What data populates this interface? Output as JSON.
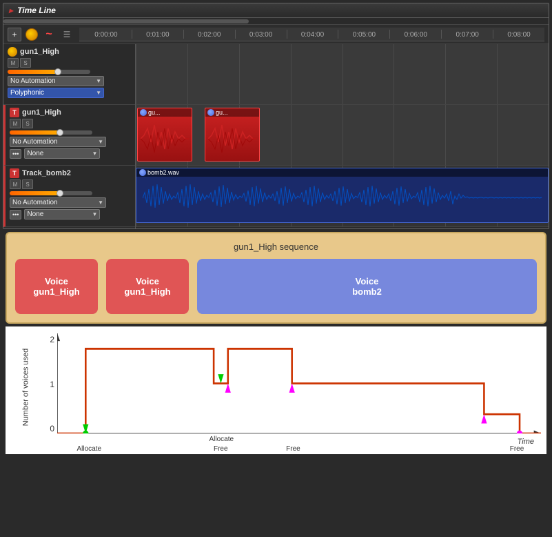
{
  "timeline": {
    "title": "Time Line",
    "toolbar": {
      "add_label": "+",
      "wave_label": "~",
      "list_label": "≡"
    },
    "ruler": {
      "marks": [
        "0:00:00",
        "0:01:00",
        "0:02:00",
        "0:03:00",
        "0:04:00",
        "0:05:00",
        "0:06:00",
        "0:07:00",
        "0:08:00"
      ]
    },
    "tracks": [
      {
        "id": "track1",
        "name": "gun1_High",
        "type": "circle",
        "automation": "No Automation",
        "mode": "Polyphonic"
      },
      {
        "id": "track2",
        "name": "gun1_High",
        "type": "T",
        "automation": "No Automation",
        "mode": "None",
        "clips": [
          {
            "label": "gu...",
            "start_pct": 0,
            "width_pct": 22
          },
          {
            "label": "gu...",
            "start_pct": 26,
            "width_pct": 18
          }
        ]
      },
      {
        "id": "track3",
        "name": "Track_bomb2",
        "type": "T",
        "automation": "No Automation",
        "mode": "None",
        "clip_label": "bomb2.wav"
      }
    ]
  },
  "sequence": {
    "title": "gun1_High sequence",
    "voices": [
      {
        "label": "Voice",
        "sublabel": "gun1_High"
      },
      {
        "label": "Voice",
        "sublabel": "gun1_High"
      }
    ],
    "bomb_voice": {
      "label": "Voice",
      "sublabel": "bomb2"
    }
  },
  "graph": {
    "y_label": "Number of voices used",
    "y_axis": [
      "2",
      "1",
      "0"
    ],
    "x_labels": [
      {
        "text": "Allocate",
        "arrow": "up",
        "arrow_color": "green"
      },
      {
        "text": "Allocate",
        "arrow": "up",
        "arrow_color": "green"
      },
      {
        "text": "Free",
        "arrow": "down",
        "arrow_color": "magenta"
      },
      {
        "text": "Free",
        "arrow": "down",
        "arrow_color": "magenta"
      },
      {
        "text": "Free",
        "arrow": "down",
        "arrow_color": "magenta"
      }
    ],
    "time_label": "Time"
  }
}
